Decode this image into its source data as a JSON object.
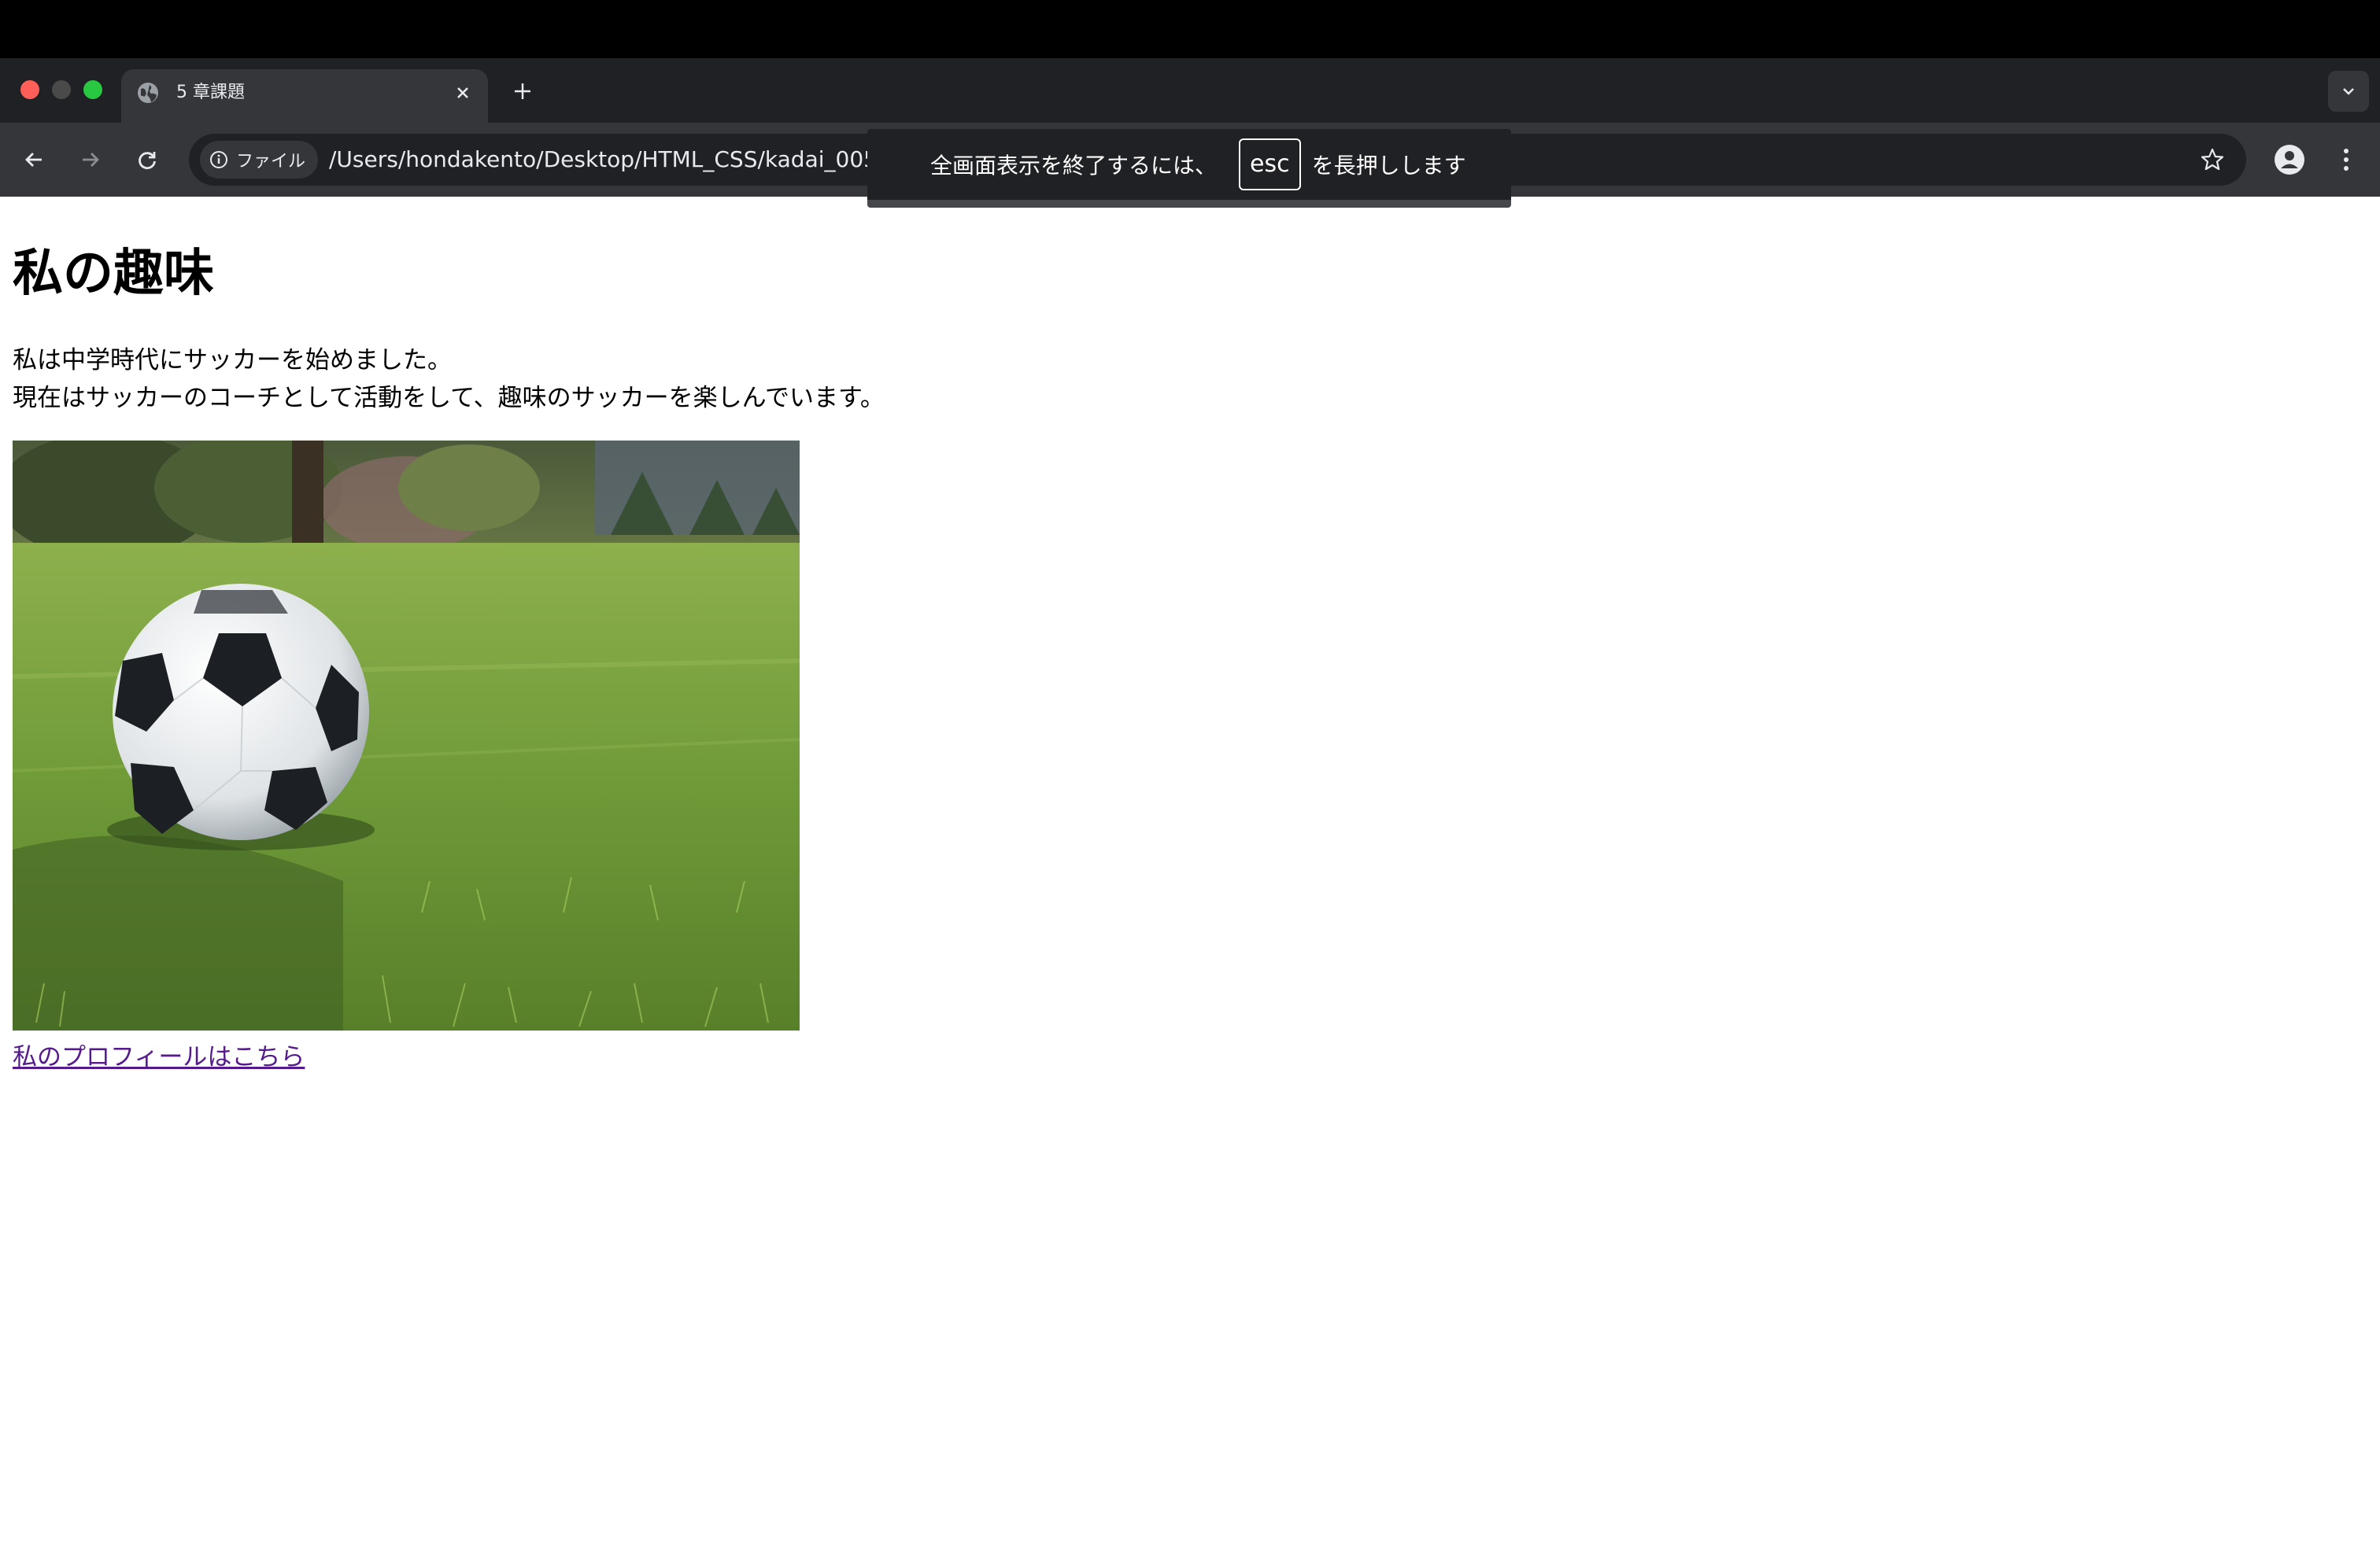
{
  "browser": {
    "tab": {
      "title": "5 章課題"
    },
    "omnibox": {
      "chip_label": "ファイル",
      "url": "/Users/hondakento/Desktop/HTML_CSS/kadai_005/html/k"
    }
  },
  "fullscreen_notice": {
    "before": "全画面表示を終了するには、",
    "key": "esc",
    "after": "を長押しします"
  },
  "page": {
    "heading": "私の趣味",
    "paragraph_line1": "私は中学時代にサッカーを始めました。",
    "paragraph_line2": "現在はサッカーのコーチとして活動をして、趣味のサッカーを楽しんでいます。",
    "image_subject": "soccer ball on grass",
    "link_text": "私のプロフィールはこちら"
  },
  "colors": {
    "link": "#551a8b",
    "toolbar": "#35363a",
    "tabstrip": "#202124"
  }
}
